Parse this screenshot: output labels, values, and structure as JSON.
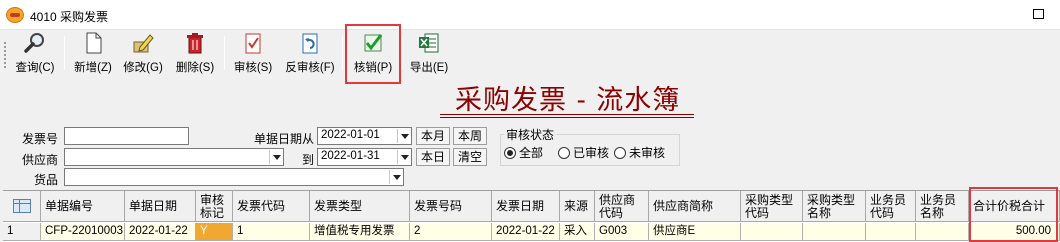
{
  "window": {
    "title": "4010 采购发票"
  },
  "toolbar": {
    "query": "查询(C)",
    "new": "新增(Z)",
    "edit": "修改(G)",
    "delete": "删除(S)",
    "audit": "审核(S)",
    "unaudit": "反审核(F)",
    "writeoff": "核销(P)",
    "export": "导出(E)"
  },
  "page_title": "采购发票 - 流水簿",
  "filters": {
    "invoice_no_label": "发票号",
    "invoice_no_value": "",
    "supplier_label": "供应商",
    "supplier_value": "",
    "goods_label": "货品",
    "goods_value": "",
    "date_from_label": "单据日期从",
    "date_from": "2022-01-01",
    "date_to_label": "到",
    "date_to": "2022-01-31",
    "btn_month": "本月",
    "btn_week": "本周",
    "btn_day": "本日",
    "btn_clear": "清空"
  },
  "audit_status": {
    "title": "审核状态",
    "options": [
      "全部",
      "已审核",
      "未审核"
    ],
    "selected": "全部"
  },
  "table": {
    "headers": {
      "doc_no": "单据编号",
      "doc_date": "单据日期",
      "audit_mark": "审核标记",
      "invoice_code": "发票代码",
      "invoice_type": "发票类型",
      "invoice_no": "发票号码",
      "invoice_date": "发票日期",
      "source": "来源",
      "supplier_code": "供应商代码",
      "supplier_short": "供应商简称",
      "purchase_type_code": "采购类型代码",
      "purchase_type_name": "采购类型名称",
      "salesman_code": "业务员代码",
      "salesman_name": "业务员名称",
      "total_tax_incl": "合计价税合计"
    },
    "rows": [
      {
        "row_no": "1",
        "doc_no": "CFP-22010003",
        "doc_date": "2022-01-22",
        "audit_mark": "Y",
        "invoice_code": "1",
        "invoice_type": "增值税专用发票",
        "invoice_no": "2",
        "invoice_date": "2022-01-22",
        "source": "采入",
        "supplier_code": "G003",
        "supplier_short": "供应商E",
        "purchase_type_code": "",
        "purchase_type_name": "",
        "salesman_code": "",
        "salesman_name": "",
        "total_tax_incl": "500.00"
      }
    ]
  },
  "colors": {
    "highlight": "#e0393e",
    "title": "#8b0000",
    "row_bg": "#ffffe8",
    "audit_cell": "#f0a830"
  }
}
